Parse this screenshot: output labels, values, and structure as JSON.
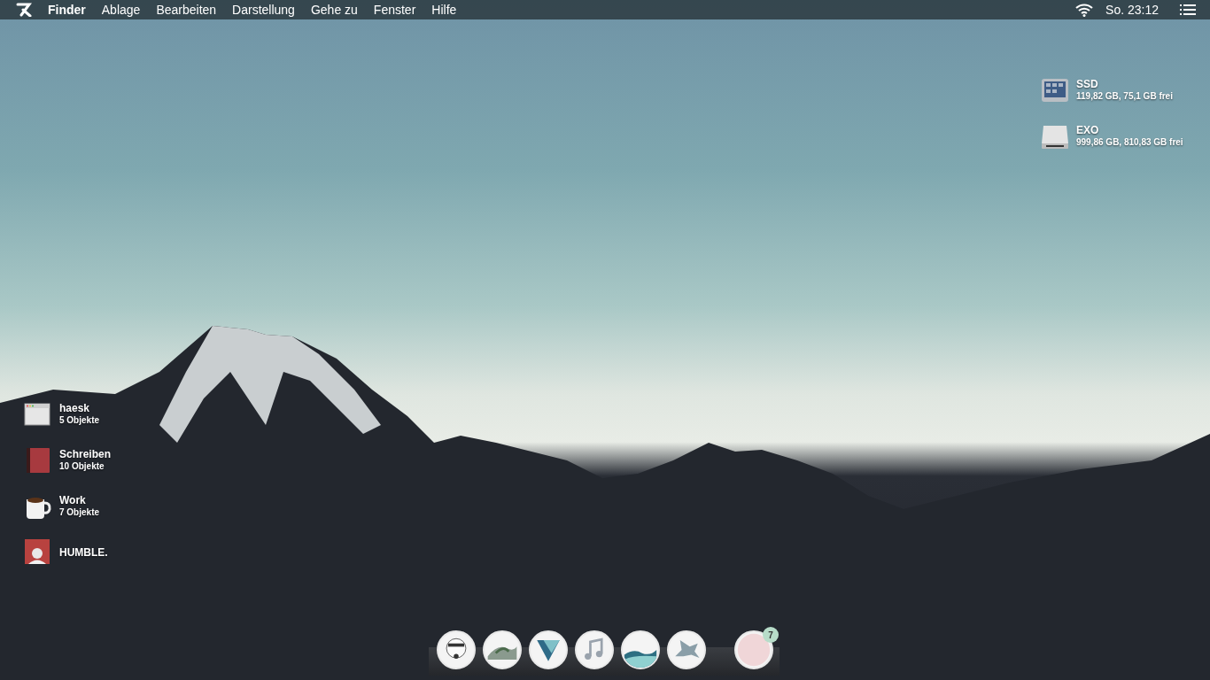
{
  "menu_bar": {
    "app": "Finder",
    "menus": [
      "Ablage",
      "Bearbeiten",
      "Darstellung",
      "Gehe zu",
      "Fenster",
      "Hilfe"
    ],
    "clock": "So. 23:12"
  },
  "drives": [
    {
      "name": "SSD",
      "info": "119,82 GB, 75,1 GB frei",
      "kind": "ssd"
    },
    {
      "name": "EXO",
      "info": "999,86 GB, 810,83 GB frei",
      "kind": "disk"
    }
  ],
  "desktop_items": [
    {
      "name": "haesk",
      "info": "5 Objekte",
      "kind": "window"
    },
    {
      "name": "Schreiben",
      "info": "10 Objekte",
      "kind": "book"
    },
    {
      "name": "Work",
      "info": "7 Objekte",
      "kind": "mug"
    },
    {
      "name": "HUMBLE.",
      "kind": "album"
    }
  ],
  "dock": [
    {
      "kind": "helmet"
    },
    {
      "kind": "wave"
    },
    {
      "kind": "chevron"
    },
    {
      "kind": "music"
    },
    {
      "kind": "sea"
    },
    {
      "kind": "pegasus"
    },
    {
      "kind": "photo",
      "badge": "7"
    }
  ]
}
